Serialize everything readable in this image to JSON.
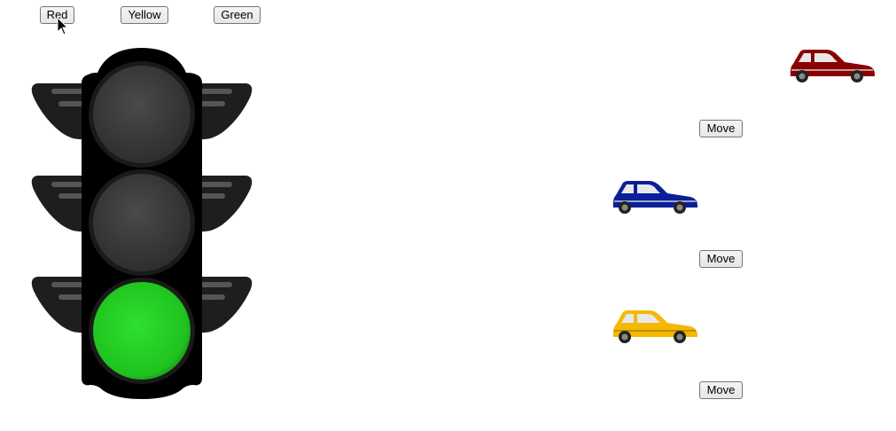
{
  "controls": {
    "red_label": "Red",
    "yellow_label": "Yellow",
    "green_label": "Green"
  },
  "traffic_light": {
    "active": "green",
    "colors": {
      "off": "#3c3c3c",
      "red": "#e02020",
      "yellow": "#f2c400",
      "green": "#22cc22",
      "housing": "#000000",
      "visor": "#1e1e1e"
    }
  },
  "cars": [
    {
      "color": "#8b0000",
      "move_label": "Move"
    },
    {
      "color": "#0a1f99",
      "move_label": "Move"
    },
    {
      "color": "#f5b800",
      "move_label": "Move"
    }
  ]
}
